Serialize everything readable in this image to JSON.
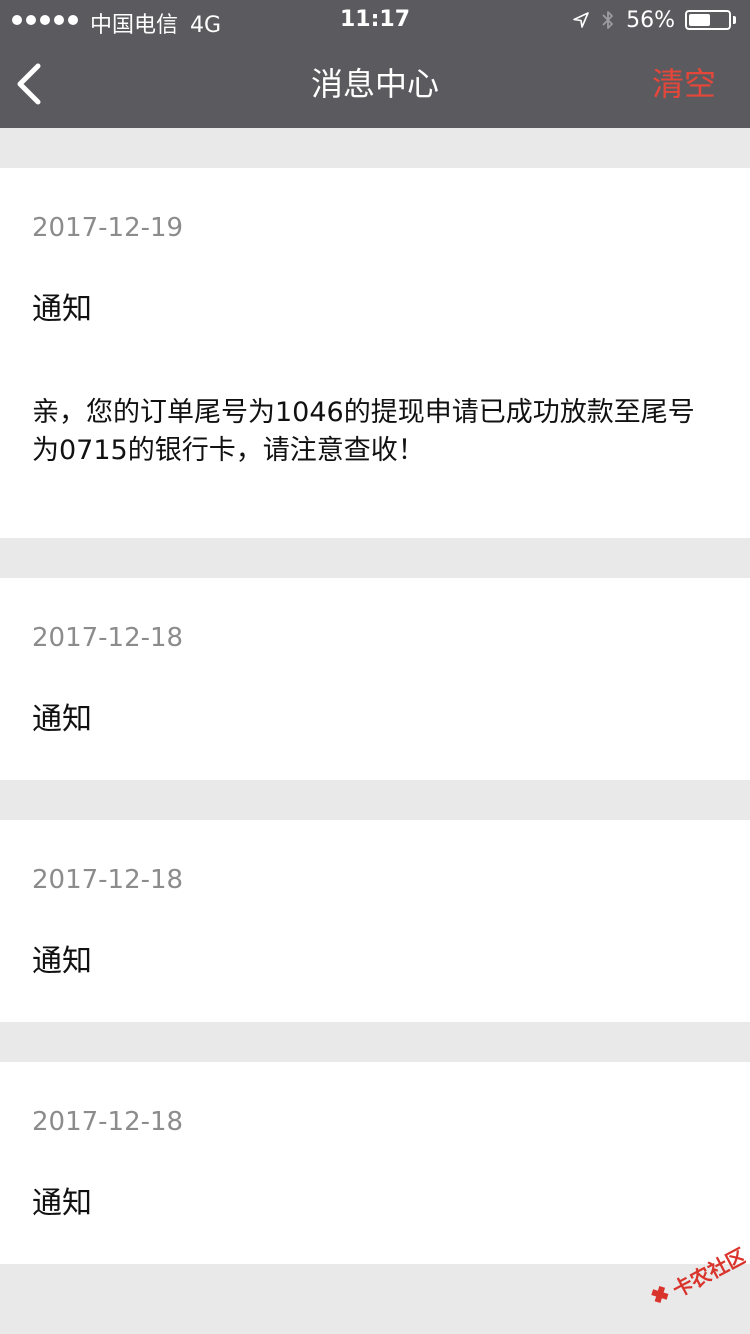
{
  "status_bar": {
    "carrier": "中国电信",
    "network": "4G",
    "time": "11:17",
    "battery_percent": "56%",
    "battery_level": 0.56
  },
  "nav": {
    "title": "消息中心",
    "clear_label": "清空"
  },
  "messages": [
    {
      "date": "2017-12-19",
      "title": "通知",
      "body": "亲，您的订单尾号为1046的提现申请已成功放款至尾号为0715的银行卡，请注意查收！"
    },
    {
      "date": "2017-12-18",
      "title": "通知",
      "body": ""
    },
    {
      "date": "2017-12-18",
      "title": "通知",
      "body": ""
    },
    {
      "date": "2017-12-18",
      "title": "通知",
      "body": ""
    }
  ],
  "colors": {
    "header_bg": "#5b5b5f",
    "accent_red": "#e4473a",
    "page_bg": "#e9e9e9",
    "card_bg": "#ffffff",
    "date_text": "#8c8c8c"
  },
  "watermark": {
    "text": "卡农社区"
  }
}
